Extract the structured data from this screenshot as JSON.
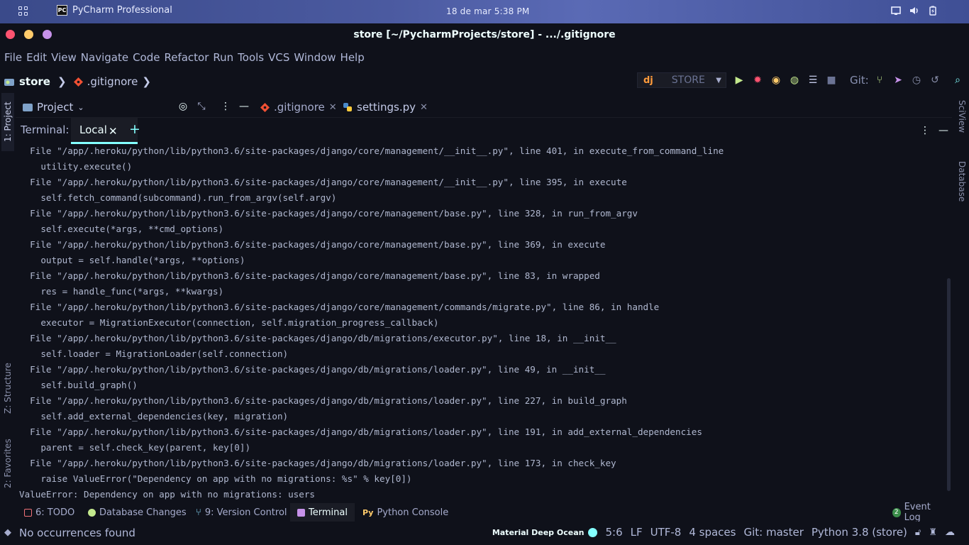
{
  "colors": {
    "background": "#0f111a",
    "accent": "#84ffff",
    "close_dot": "#ff5370",
    "minimize_dot": "#ffcb6b",
    "maximize_dot": "#c792ea",
    "run_green": "#c3e88d",
    "git_branch": "#89ddff"
  },
  "system_bar": {
    "app_name": "PyCharm Professional",
    "clock": "18 de mar  5:38 PM",
    "icons": [
      "apps-grid-icon",
      "screen-icon",
      "volume-icon",
      "battery-icon"
    ]
  },
  "window": {
    "title": "store [~/PycharmProjects/store] - .../.gitignore"
  },
  "menu": [
    "File",
    "Edit",
    "View",
    "Navigate",
    "Code",
    "Refactor",
    "Run",
    "Tools",
    "VCS",
    "Window",
    "Help"
  ],
  "breadcrumb": {
    "project": "store",
    "file": ".gitignore"
  },
  "run_config": {
    "prefix": "dj",
    "name": "STORE"
  },
  "git_label": "Git:",
  "left_tool_tabs": [
    "1: Project",
    "Z: Structure",
    "2: Favorites"
  ],
  "right_tool_tabs": [
    "SciView",
    "Database"
  ],
  "project_panel": {
    "title": "Project"
  },
  "editor_tabs": [
    {
      "label": ".gitignore",
      "active": true
    },
    {
      "label": "settings.py",
      "active": false
    }
  ],
  "terminal": {
    "label": "Terminal:",
    "tab": "Local",
    "lines": [
      "  File \"/app/.heroku/python/lib/python3.6/site-packages/django/core/management/__init__.py\", line 401, in execute_from_command_line",
      "    utility.execute()",
      "  File \"/app/.heroku/python/lib/python3.6/site-packages/django/core/management/__init__.py\", line 395, in execute",
      "    self.fetch_command(subcommand).run_from_argv(self.argv)",
      "  File \"/app/.heroku/python/lib/python3.6/site-packages/django/core/management/base.py\", line 328, in run_from_argv",
      "    self.execute(*args, **cmd_options)",
      "  File \"/app/.heroku/python/lib/python3.6/site-packages/django/core/management/base.py\", line 369, in execute",
      "    output = self.handle(*args, **options)",
      "  File \"/app/.heroku/python/lib/python3.6/site-packages/django/core/management/base.py\", line 83, in wrapped",
      "    res = handle_func(*args, **kwargs)",
      "  File \"/app/.heroku/python/lib/python3.6/site-packages/django/core/management/commands/migrate.py\", line 86, in handle",
      "    executor = MigrationExecutor(connection, self.migration_progress_callback)",
      "  File \"/app/.heroku/python/lib/python3.6/site-packages/django/db/migrations/executor.py\", line 18, in __init__",
      "    self.loader = MigrationLoader(self.connection)",
      "  File \"/app/.heroku/python/lib/python3.6/site-packages/django/db/migrations/loader.py\", line 49, in __init__",
      "    self.build_graph()",
      "  File \"/app/.heroku/python/lib/python3.6/site-packages/django/db/migrations/loader.py\", line 227, in build_graph",
      "    self.add_external_dependencies(key, migration)",
      "  File \"/app/.heroku/python/lib/python3.6/site-packages/django/db/migrations/loader.py\", line 191, in add_external_dependencies",
      "    parent = self.check_key(parent, key[0])",
      "  File \"/app/.heroku/python/lib/python3.6/site-packages/django/db/migrations/loader.py\", line 173, in check_key",
      "    raise ValueError(\"Dependency on app with no migrations: %s\" % key[0])",
      "ValueError: Dependency on app with no migrations: users"
    ]
  },
  "tool_tabs": [
    {
      "label": "6: TODO",
      "icon": "todo-icon",
      "active": false
    },
    {
      "label": "Database Changes",
      "icon": "database-changes-icon",
      "active": false
    },
    {
      "label": "9: Version Control",
      "icon": "version-control-icon",
      "active": false
    },
    {
      "label": "Terminal",
      "icon": "terminal-icon",
      "active": true
    },
    {
      "label": "Python Console",
      "icon": "python-console-icon",
      "active": false
    }
  ],
  "event_log": {
    "count": "2",
    "label": "Event Log"
  },
  "status": {
    "message": "No occurrences found",
    "theme": "Material Deep Ocean",
    "position": "5:6",
    "line_sep": "LF",
    "encoding": "UTF-8",
    "indent": "4 spaces",
    "git_branch": "Git: master",
    "interpreter": "Python 3.8 (store)"
  }
}
